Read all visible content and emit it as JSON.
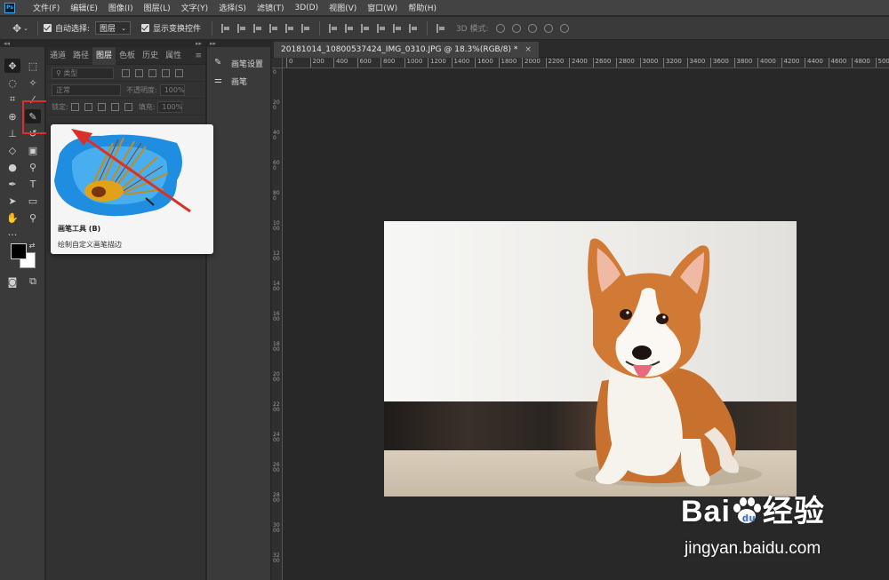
{
  "app": {
    "logo": "Ps"
  },
  "menu": [
    "文件(F)",
    "编辑(E)",
    "图像(I)",
    "图层(L)",
    "文字(Y)",
    "选择(S)",
    "滤镜(T)",
    "3D(D)",
    "视图(V)",
    "窗口(W)",
    "帮助(H)"
  ],
  "options_bar": {
    "auto_select_label": "自动选择:",
    "auto_select_value": "图层",
    "show_transform_label": "显示变换控件",
    "mode_3d_label": "3D 模式:"
  },
  "layers_panel": {
    "tabs": [
      "通道",
      "路径",
      "图层",
      "色板",
      "历史",
      "属性"
    ],
    "active_tab": "图层",
    "filter_placeholder": "类型",
    "blend_mode": "正常",
    "opacity_label": "不透明度:",
    "opacity_value": "100%",
    "lock_label": "锁定:",
    "fill_label": "填充:",
    "fill_value": "100%"
  },
  "side_panel": {
    "items": [
      {
        "label": "画笔设置",
        "icon": "brush-settings-icon"
      },
      {
        "label": "画笔",
        "icon": "brush-preset-icon"
      }
    ]
  },
  "document": {
    "tab_title": "20181014_10800537424_IMG_0310.JPG @ 18.3%(RGB/8) *",
    "close_glyph": "×"
  },
  "ruler": {
    "h_labels": [
      "0",
      "200",
      "400",
      "600",
      "800",
      "1000",
      "1200",
      "1400",
      "1600",
      "1800",
      "2000",
      "2200",
      "2400",
      "2600",
      "2800",
      "3000",
      "3200",
      "3400",
      "3600",
      "3800",
      "4000",
      "4200",
      "4400",
      "4600",
      "4800",
      "5000",
      "5200",
      "5400"
    ],
    "v_labels": [
      "0",
      "200",
      "400",
      "600",
      "800",
      "1000",
      "1200",
      "1400",
      "1600",
      "1800",
      "2000",
      "2200",
      "2400",
      "2600",
      "2800",
      "3000",
      "3200",
      "3400"
    ]
  },
  "tooltip": {
    "title": "画笔工具 (B)",
    "description": "绘制自定义画笔描边"
  },
  "colors": {
    "foreground": "#000000",
    "background": "#ffffff",
    "highlight": "#d9302a"
  },
  "watermark": {
    "brand": "Bai",
    "brand_cn": "经验",
    "url": "jingyan.baidu.com"
  }
}
